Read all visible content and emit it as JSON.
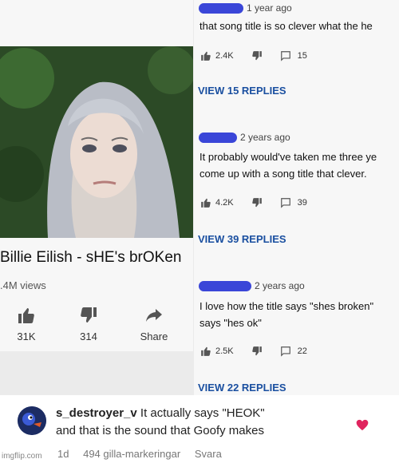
{
  "video": {
    "title": "Billie Eilish - sHE's brOKen",
    "views": ".4M views",
    "like_count": "31K",
    "dislike_count": "314",
    "share_label": "Share"
  },
  "comments": [
    {
      "ago": "1 year ago",
      "lines": [
        "that song title is so clever what the he"
      ],
      "likes": "2.4K",
      "reply_count": "15",
      "view_replies": "VIEW 15 REPLIES"
    },
    {
      "ago": "2 years ago",
      "lines": [
        "It probably would've taken me three ye",
        "come up with a song title that clever."
      ],
      "likes": "4.2K",
      "reply_count": "39",
      "view_replies": "VIEW 39 REPLIES"
    },
    {
      "ago": "2 years ago",
      "lines": [
        "I love how the title says \"shes broken\"",
        "says \"hes ok\""
      ],
      "likes": "2.5K",
      "reply_count": "22",
      "view_replies": "VIEW 22 REPLIES"
    }
  ],
  "bottom_comment": {
    "username": "s_destroyer_v",
    "text_line1": "It actually says \"HEOK\"",
    "text_line2": "and that is the sound that Goofy makes",
    "age": "1d",
    "likes": "494 gilla-markeringar",
    "reply": "Svara"
  },
  "watermark": "imgflip.com",
  "colors": {
    "accent_blue": "#1a4fa0",
    "redaction_blue": "#3a46d8",
    "heart_red": "#e0245e"
  }
}
